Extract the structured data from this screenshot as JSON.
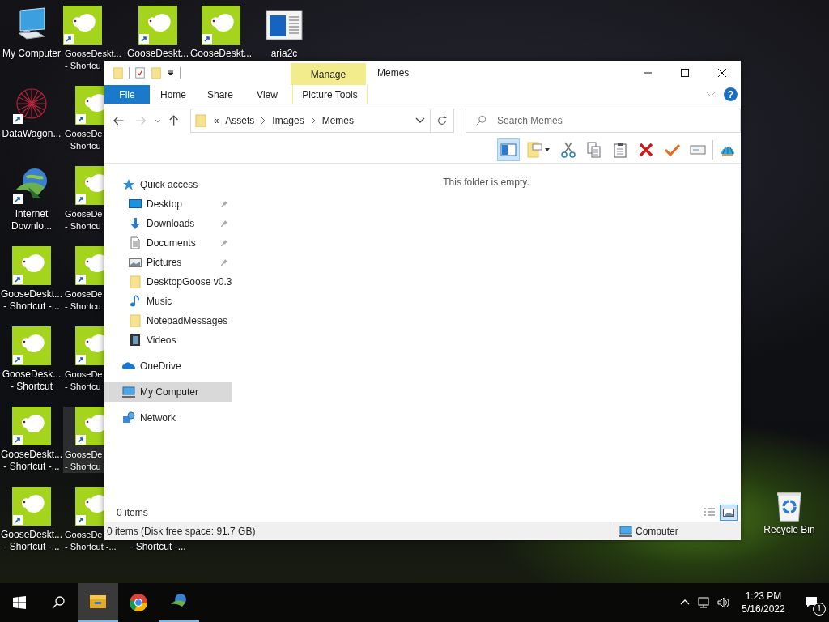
{
  "desktop": {
    "rows": [
      [
        {
          "kind": "computer",
          "label": [
            "My Computer"
          ],
          "selected": false
        },
        {
          "kind": "goose",
          "label": [
            "GooseDeskt...",
            "- Shortcu"
          ],
          "label_partly_covered": true,
          "selected": false
        },
        {
          "kind": "goose",
          "label": [
            "GooseDeskt..."
          ],
          "selected": false
        },
        {
          "kind": "goose",
          "label": [
            "GooseDeskt..."
          ],
          "selected": false
        },
        {
          "kind": "aria",
          "label": [
            "aria2c"
          ],
          "selected": false
        }
      ],
      [
        {
          "kind": "web",
          "label": [
            "DataWagon..."
          ],
          "selected": false
        },
        {
          "kind": "goose",
          "label": [
            "GooseDe",
            "- Shortcu"
          ],
          "icon_partly_covered": true,
          "label_partly_covered": true,
          "selected": false
        }
      ],
      [
        {
          "kind": "idm",
          "label": [
            "Internet",
            "Downlo..."
          ],
          "selected": false
        },
        {
          "kind": "goose",
          "label": [
            "GooseDe",
            "- Shortcu"
          ],
          "icon_partly_covered": true,
          "label_partly_covered": true,
          "selected": false
        }
      ],
      [
        {
          "kind": "goose",
          "label": [
            "GooseDeskt...",
            "- Shortcut -..."
          ],
          "selected": false
        },
        {
          "kind": "goose",
          "label": [
            "GooseDe",
            "- Shortcu"
          ],
          "icon_partly_covered": true,
          "label_partly_covered": true,
          "selected": false
        }
      ],
      [
        {
          "kind": "goose",
          "label": [
            "GooseDesk...",
            "- Shortcut"
          ],
          "selected": false
        },
        {
          "kind": "goose",
          "label": [
            "GooseDe",
            "- Shortcu"
          ],
          "icon_partly_covered": true,
          "label_partly_covered": true,
          "selected": false
        }
      ],
      [
        {
          "kind": "goose",
          "label": [
            "GooseDeskt...",
            "- Shortcut -..."
          ],
          "selected": false
        },
        {
          "kind": "goose",
          "label": [
            "GooseDe",
            "- Shortcu"
          ],
          "icon_partly_covered": true,
          "label_partly_covered": true,
          "selected": true
        }
      ],
      [
        {
          "kind": "goose",
          "label": [
            "GooseDeskt...",
            "- Shortcut -..."
          ],
          "selected": false
        },
        {
          "kind": "goose",
          "label": [
            "GooseDe",
            "- Shortcut -..."
          ],
          "icon_partly_covered": true,
          "label_partly_covered": true,
          "selected": false
        },
        {
          "label": [
            "- Shortcut -..."
          ],
          "icon_covered": true,
          "selected": false
        }
      ]
    ],
    "recycle_bin": {
      "label": "Recycle Bin"
    }
  },
  "explorer": {
    "contextual_tab": "Manage",
    "title": "Memes",
    "ribbon_tabs": [
      {
        "label": "File",
        "kind": "file",
        "selected": false
      },
      {
        "label": "Home",
        "kind": "plain",
        "selected": false
      },
      {
        "label": "Share",
        "kind": "plain",
        "selected": false
      },
      {
        "label": "View",
        "kind": "plain",
        "selected": false
      },
      {
        "label": "Picture Tools",
        "kind": "contextual",
        "selected": false
      }
    ],
    "help": "?",
    "forward": {
      "disabled": true
    },
    "address": {
      "overflow": "«",
      "breadcrumbs": [
        "Assets",
        "Images",
        "Memes"
      ]
    },
    "search": {
      "placeholder": "Search Memes"
    },
    "toolbar": [
      {
        "kind": "preview-pane",
        "on": true
      },
      {
        "kind": "new-folder"
      },
      {
        "kind": "cut"
      },
      {
        "kind": "copy"
      },
      {
        "kind": "paste"
      },
      {
        "kind": "delete"
      },
      {
        "kind": "check"
      },
      {
        "kind": "rename"
      },
      {
        "kind": "shell"
      }
    ],
    "nav_pane": [
      {
        "label": "Quick access",
        "kind": "star",
        "selected": false,
        "children": [
          {
            "label": "Desktop",
            "kind": "desktop",
            "pinned": true,
            "selected": false
          },
          {
            "label": "Downloads",
            "kind": "downloads",
            "pinned": true,
            "selected": false
          },
          {
            "label": "Documents",
            "kind": "documents",
            "pinned": true,
            "selected": false
          },
          {
            "label": "Pictures",
            "kind": "pictures",
            "pinned": true,
            "selected": false
          },
          {
            "label": "DesktopGoose v0.3",
            "kind": "folder",
            "pinned": false,
            "selected": false
          },
          {
            "label": "Music",
            "kind": "music",
            "pinned": false,
            "selected": false
          },
          {
            "label": "NotepadMessages",
            "kind": "folder",
            "pinned": false,
            "selected": false
          },
          {
            "label": "Videos",
            "kind": "videos",
            "pinned": false,
            "selected": false
          }
        ]
      },
      {
        "label": "OneDrive",
        "kind": "cloud",
        "selected": false
      },
      {
        "label": "My Computer",
        "kind": "computer",
        "selected": true
      },
      {
        "label": "Network",
        "kind": "network",
        "selected": false
      }
    ],
    "empty_message": "This folder is empty.",
    "item_count": "0 items",
    "views": [
      {
        "kind": "details",
        "selected": false
      },
      {
        "kind": "large-icons",
        "selected": true
      }
    ],
    "status_bar": {
      "text": "0 items (Disk free space: 91.7 GB)",
      "location": "Computer"
    }
  },
  "taskbar": {
    "apps": [
      {
        "kind": "explorer",
        "running": true,
        "active": true
      },
      {
        "kind": "chrome",
        "running": false,
        "active": false
      },
      {
        "kind": "idm",
        "running": true,
        "active": false
      }
    ],
    "time": "1:23 PM",
    "date": "5/16/2022",
    "notifications": "1"
  }
}
